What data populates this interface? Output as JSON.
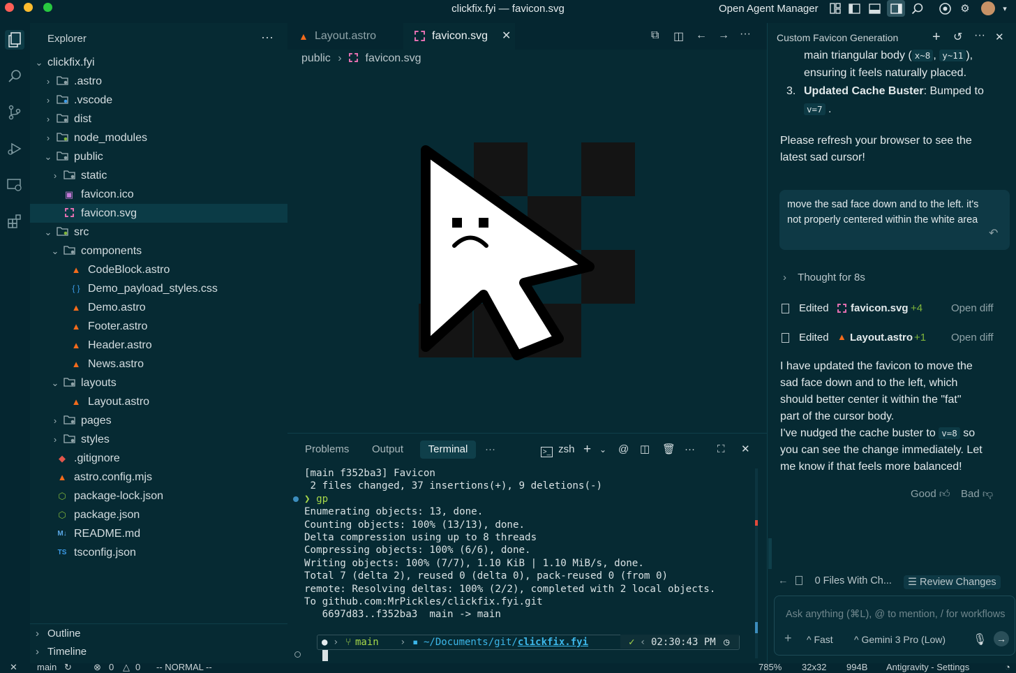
{
  "window": {
    "title": "clickfix.fyi — favicon.svg",
    "agent_manager": "Open Agent Manager"
  },
  "explorer": {
    "title": "Explorer",
    "root": "clickfix.fyi",
    "items": [
      {
        "label": ".astro",
        "depth": 1,
        "chev": "›",
        "icon": "folder-icon"
      },
      {
        "label": ".vscode",
        "depth": 1,
        "chev": "›",
        "icon": "folder-vscode-icon"
      },
      {
        "label": "dist",
        "depth": 1,
        "chev": "›",
        "icon": "folder-dist-icon"
      },
      {
        "label": "node_modules",
        "depth": 1,
        "chev": "›",
        "icon": "folder-node-icon"
      },
      {
        "label": "public",
        "depth": 1,
        "chev": "⌄",
        "icon": "folder-public-icon"
      },
      {
        "label": "static",
        "depth": 2,
        "chev": "›",
        "icon": "folder-static-icon"
      },
      {
        "label": "favicon.ico",
        "depth": 2,
        "chev": "",
        "icon": "image-file-icon"
      },
      {
        "label": "favicon.svg",
        "depth": 2,
        "chev": "",
        "icon": "svg-file-icon"
      },
      {
        "label": "src",
        "depth": 1,
        "chev": "⌄",
        "icon": "folder-src-icon"
      },
      {
        "label": "components",
        "depth": 2,
        "chev": "⌄",
        "icon": "folder-components-icon"
      },
      {
        "label": "CodeBlock.astro",
        "depth": 3,
        "chev": "",
        "icon": "astro-file-icon"
      },
      {
        "label": "Demo_payload_styles.css",
        "depth": 3,
        "chev": "",
        "icon": "css-file-icon"
      },
      {
        "label": "Demo.astro",
        "depth": 3,
        "chev": "",
        "icon": "astro-file-icon"
      },
      {
        "label": "Footer.astro",
        "depth": 3,
        "chev": "",
        "icon": "astro-file-icon"
      },
      {
        "label": "Header.astro",
        "depth": 3,
        "chev": "",
        "icon": "astro-file-icon"
      },
      {
        "label": "News.astro",
        "depth": 3,
        "chev": "",
        "icon": "astro-file-icon"
      },
      {
        "label": "layouts",
        "depth": 2,
        "chev": "⌄",
        "icon": "folder-layouts-icon"
      },
      {
        "label": "Layout.astro",
        "depth": 3,
        "chev": "",
        "icon": "astro-file-icon"
      },
      {
        "label": "pages",
        "depth": 2,
        "chev": "›",
        "icon": "folder-icon"
      },
      {
        "label": "styles",
        "depth": 2,
        "chev": "›",
        "icon": "folder-styles-icon"
      },
      {
        "label": ".gitignore",
        "depth": 1,
        "chev": "",
        "icon": "git-file-icon"
      },
      {
        "label": "astro.config.mjs",
        "depth": 1,
        "chev": "",
        "icon": "astro-file-icon"
      },
      {
        "label": "package-lock.json",
        "depth": 1,
        "chev": "",
        "icon": "node-file-icon"
      },
      {
        "label": "package.json",
        "depth": 1,
        "chev": "",
        "icon": "node-file-icon"
      },
      {
        "label": "README.md",
        "depth": 1,
        "chev": "",
        "icon": "markdown-file-icon"
      },
      {
        "label": "tsconfig.json",
        "depth": 1,
        "chev": "",
        "icon": "ts-config-icon"
      }
    ],
    "outline": "Outline",
    "timeline": "Timeline"
  },
  "editor": {
    "tabs": [
      {
        "label": "Layout.astro",
        "active": false
      },
      {
        "label": "favicon.svg",
        "active": true
      }
    ],
    "breadcrumb": [
      "public",
      "favicon.svg"
    ]
  },
  "panel": {
    "tabs": [
      "Problems",
      "Output",
      "Terminal"
    ],
    "active_tab": "Terminal",
    "shell": "zsh",
    "terminal_lines": [
      "[main f352ba3] Favicon",
      " 2 files changed, 37 insertions(+), 9 deletions(-)",
      "❯ gp",
      "Enumerating objects: 13, done.",
      "Counting objects: 100% (13/13), done.",
      "Delta compression using up to 8 threads",
      "Compressing objects: 100% (6/6), done.",
      "Writing objects: 100% (7/7), 1.10 KiB | 1.10 MiB/s, done.",
      "Total 7 (delta 2), reused 0 (delta 0), pack-reused 0 (from 0)",
      "remote: Resolving deltas: 100% (2/2), completed with 2 local objects.",
      "To github.com:MrPickles/clickfix.fyi.git",
      "   6697d83..f352ba3  main -> main"
    ],
    "prompt": {
      "branch": "main",
      "path_prefix": "~/Documents/git/",
      "path_repo": "clickfix.fyi",
      "check": "✓",
      "time": "02:30:43 PM"
    }
  },
  "chat": {
    "title": "Custom Favicon Generation",
    "frag1_a": "main triangular body (",
    "frag1_code1": "x~8",
    "frag1_code2": "y~11",
    "frag1_b": "),",
    "frag2": "ensuring it feels naturally placed.",
    "item3_num": "3.",
    "item3_bold": "Updated Cache Buster",
    "item3_text": ": Bumped to",
    "item3_code": "v=7",
    "refresh_1": "Please refresh your browser to see the",
    "refresh_2": "latest sad cursor!",
    "user_msg": "move the sad face down and to the left. it's not properly centered within the white area",
    "thought": "Thought for 8s",
    "edits": [
      {
        "verb": "Edited",
        "file": "favicon.svg",
        "delta": "+4",
        "action": "Open diff"
      },
      {
        "verb": "Edited",
        "file": "Layout.astro",
        "delta": "+1",
        "action": "Open diff"
      }
    ],
    "reply_lines": [
      "I have updated the favicon to move the",
      "sad face down and to the left, which",
      "should better center it within the \"fat\"",
      "part of the cursor body."
    ],
    "reply2_a": "I've nudged the cache buster to",
    "reply2_code": "v=8",
    "reply2_b": "so",
    "reply2_lines": [
      "you can see the change immediately. Let",
      "me know if that feels more balanced!"
    ],
    "good": "Good",
    "bad": "Bad",
    "files_changed": "0 Files With Ch...",
    "review": "Review Changes",
    "input_placeholder": "Ask anything (⌘L), @ to mention, / for workflows",
    "mode": "Fast",
    "model": "Gemini 3 Pro (Low)"
  },
  "status": {
    "branch": "main",
    "errors": "0",
    "warnings": "0",
    "mode": "-- NORMAL --",
    "zoom": "785%",
    "dims": "32x32",
    "size": "994B",
    "settings": "Antigravity - Settings"
  },
  "colors": {
    "bg": "#062a33",
    "accent": "#2f7fa8",
    "astro": "#f36b1c",
    "svg": "#e36fb0",
    "diff_add": "#7fb53b"
  }
}
